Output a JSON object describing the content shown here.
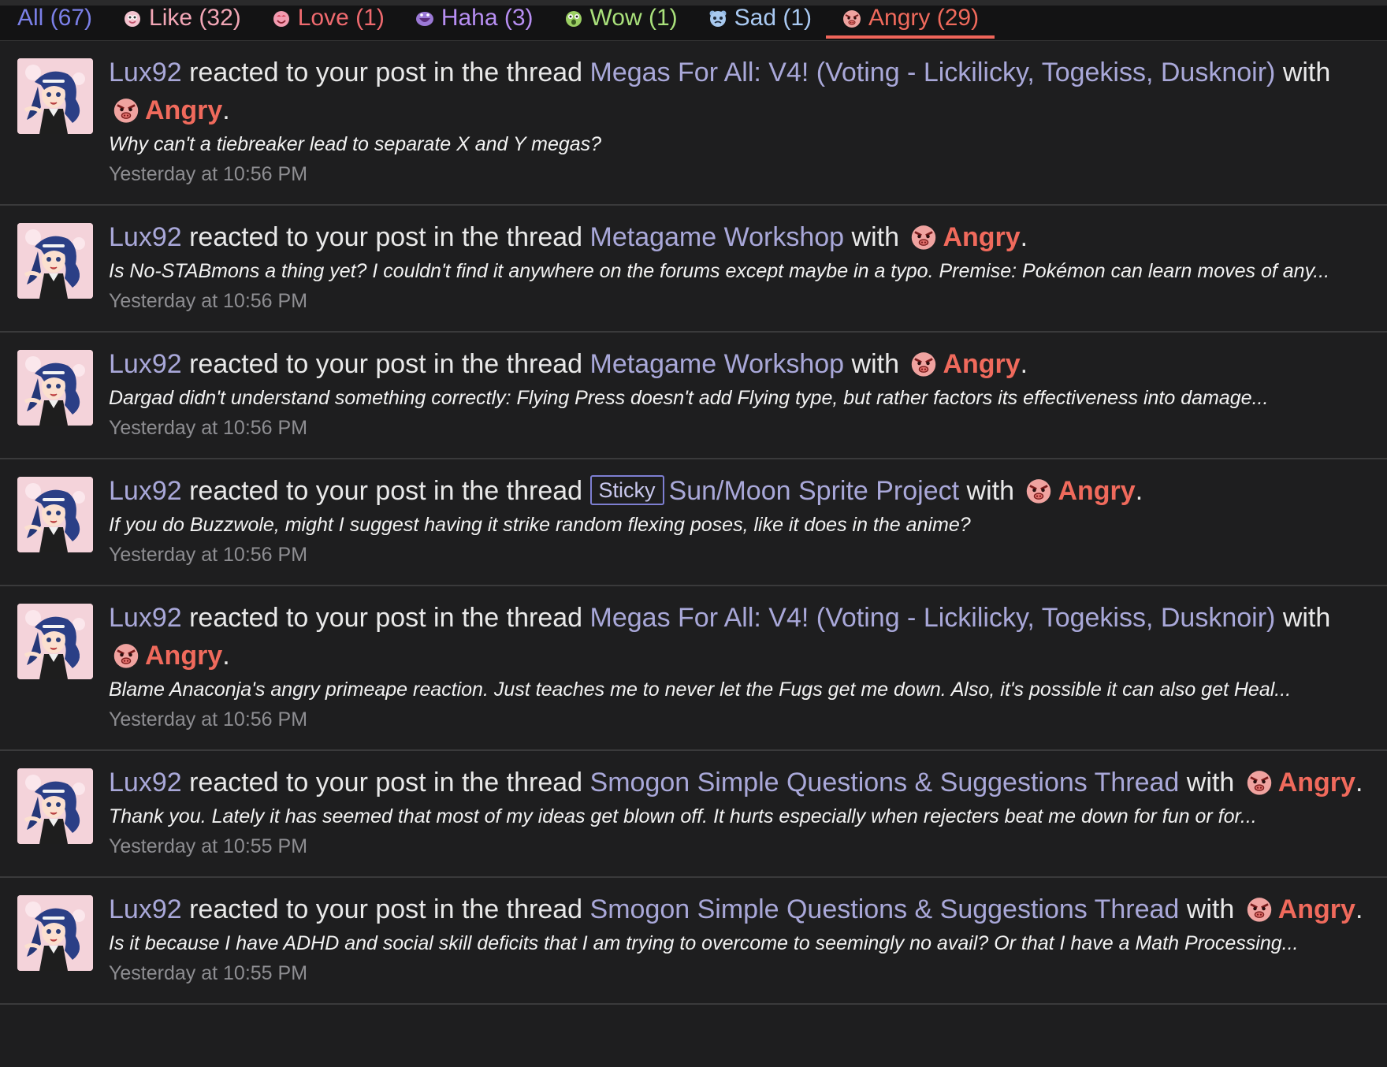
{
  "tabs": [
    {
      "label": "All (67)",
      "icon": "",
      "active": false
    },
    {
      "label": "Like (32)",
      "icon": "like-reaction-icon",
      "active": false
    },
    {
      "label": "Love (1)",
      "icon": "love-reaction-icon",
      "active": false
    },
    {
      "label": "Haha (3)",
      "icon": "haha-reaction-icon",
      "active": false
    },
    {
      "label": "Wow (1)",
      "icon": "wow-reaction-icon",
      "active": false
    },
    {
      "label": "Sad (1)",
      "icon": "sad-reaction-icon",
      "active": true
    },
    {
      "label": "Angry (29)",
      "icon": "angry-reaction-icon",
      "active": true
    }
  ],
  "colors": {
    "angry": "#f06a5c",
    "link": "#a9a8d9",
    "background": "#1e1e1f"
  },
  "common": {
    "user": "Lux92",
    "action": "reacted to your post in the thread",
    "with": "with",
    "reaction": "Angry",
    "period": "."
  },
  "alerts": [
    {
      "thread": "Megas For All: V4! (Voting - Lickilicky, Togekiss, Dusknoir)",
      "sticky": "",
      "snippet": "Why can't a tiebreaker lead to separate X and Y megas?",
      "time": "Yesterday at 10:56 PM"
    },
    {
      "thread": "Metagame Workshop",
      "sticky": "",
      "snippet": "Is No-STABmons a thing yet? I couldn't find it anywhere on the forums except maybe in a typo. Premise: Pokémon can learn moves of any...",
      "time": "Yesterday at 10:56 PM"
    },
    {
      "thread": "Metagame Workshop",
      "sticky": "",
      "snippet": "Dargad didn't understand something correctly: Flying Press doesn't add Flying type, but rather factors its effectiveness into damage...",
      "time": "Yesterday at 10:56 PM"
    },
    {
      "thread": "Sun/Moon Sprite Project",
      "sticky": "Sticky",
      "snippet": "If you do Buzzwole, might I suggest having it strike random flexing poses, like it does in the anime?",
      "time": "Yesterday at 10:56 PM"
    },
    {
      "thread": "Megas For All: V4! (Voting - Lickilicky, Togekiss, Dusknoir)",
      "sticky": "",
      "snippet": "Blame Anaconja's angry primeape reaction. Just teaches me to never let the Fugs get me down. Also, it's possible it can also get Heal...",
      "time": "Yesterday at 10:56 PM"
    },
    {
      "thread": "Smogon Simple Questions & Suggestions Thread",
      "sticky": "",
      "snippet": "Thank you. Lately it has seemed that most of my ideas get blown off. It hurts especially when rejecters beat me down for fun or for...",
      "time": "Yesterday at 10:55 PM"
    },
    {
      "thread": "Smogon Simple Questions & Suggestions Thread",
      "sticky": "",
      "snippet": "Is it because I have ADHD and social skill deficits that I am trying to overcome to seemingly no avail? Or that I have a Math Processing...",
      "time": "Yesterday at 10:55 PM"
    }
  ]
}
